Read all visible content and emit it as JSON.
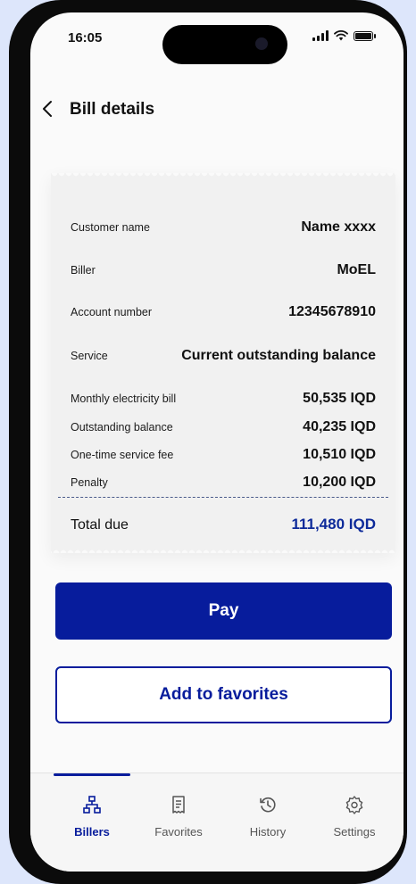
{
  "status_bar": {
    "time": "16:05"
  },
  "header": {
    "title": "Bill details"
  },
  "receipt": {
    "customer_name_label": "Customer name",
    "customer_name_value": "Name xxxx",
    "biller_label": "Biller",
    "biller_value": "MoEL",
    "account_label": "Account number",
    "account_value": "12345678910",
    "service_label": "Service",
    "service_value": "Current outstanding balance",
    "items": [
      {
        "label": "Monthly electricity bill",
        "value": "50,535 IQD"
      },
      {
        "label": "Outstanding balance",
        "value": "40,235 IQD"
      },
      {
        "label": "One-time service fee",
        "value": "10,510 IQD"
      },
      {
        "label": "Penalty",
        "value": "10,200 IQD"
      }
    ],
    "total_label": "Total due",
    "total_value": "111,480 IQD"
  },
  "actions": {
    "pay_label": "Pay",
    "favorite_label": "Add to favorites"
  },
  "bottom_nav": {
    "items": [
      {
        "label": "Billers",
        "icon": "sitemap-icon",
        "active": true
      },
      {
        "label": "Favorites",
        "icon": "receipt-icon",
        "active": false
      },
      {
        "label": "History",
        "icon": "history-icon",
        "active": false
      },
      {
        "label": "Settings",
        "icon": "gear-icon",
        "active": false
      }
    ]
  },
  "colors": {
    "primary": "#071c9c",
    "total_text": "#0d2a9a",
    "background": "#dde6fb"
  }
}
